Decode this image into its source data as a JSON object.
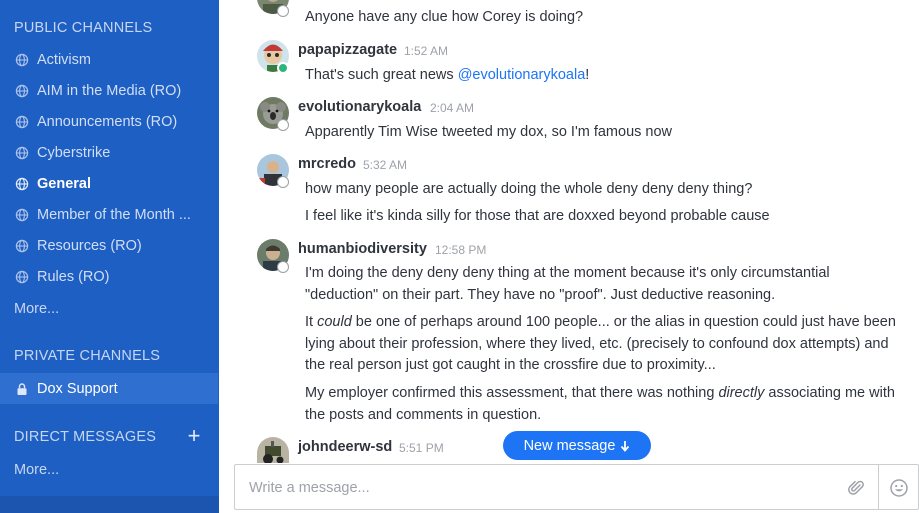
{
  "sidebar": {
    "public_title": "PUBLIC CHANNELS",
    "public_channels": [
      {
        "label": "Activism"
      },
      {
        "label": "AIM in the Media (RO)"
      },
      {
        "label": "Announcements (RO)"
      },
      {
        "label": "Cyberstrike"
      },
      {
        "label": "General"
      },
      {
        "label": "Member of the Month ..."
      },
      {
        "label": "Resources (RO)"
      },
      {
        "label": "Rules (RO)"
      }
    ],
    "public_more": "More...",
    "private_title": "PRIVATE CHANNELS",
    "private_channels": [
      {
        "label": "Dox Support"
      }
    ],
    "direct_title": "DIRECT MESSAGES",
    "direct_add": "+",
    "direct_more": "More...",
    "colors": {
      "background": "#1e5fc4",
      "selected": "#2f6fd0"
    }
  },
  "messages": [
    {
      "lines": [
        "Anyone have any clue how Corey is doing?"
      ]
    },
    {
      "user": "papapizzagate",
      "time": "1:52 AM",
      "status": "online",
      "text_before": "That's such great news ",
      "mention": "@evolutionarykoala",
      "text_after": "!"
    },
    {
      "user": "evolutionarykoala",
      "time": "2:04 AM",
      "status": "offline",
      "lines": [
        "Apparently Tim Wise tweeted my dox, so I'm famous now"
      ]
    },
    {
      "user": "mrcredo",
      "time": "5:32 AM",
      "status": "offline",
      "lines": [
        "how many people are actually doing the whole deny deny deny thing?",
        "I feel like it's kinda silly for those that are doxxed beyond probable cause"
      ]
    },
    {
      "user": "humanbiodiversity",
      "time": "12:58 PM",
      "status": "offline",
      "p1": "I'm doing the deny deny deny thing at the moment because it's only circumstantial \"deduction\" on their part. They have no \"proof\". Just deductive reasoning.",
      "p2_a": "It ",
      "p2_em": "could",
      "p2_b": " be one of perhaps around 100 people... or the alias in question could just have been lying about their profession, where they lived, etc. (precisely to confound dox attempts) and the real person just got caught in the crossfire due to proximity...",
      "p3_a": "My employer confirmed this assessment, that there was nothing ",
      "p3_em": "directly",
      "p3_b": " associating me with the posts and comments in question."
    },
    {
      "user": "johndeerw-sd",
      "time": "5:51 PM",
      "status": "offline"
    }
  ],
  "new_message_label": "New message",
  "composer": {
    "placeholder": "Write a message..."
  },
  "icons": {
    "channel": "globe-icon",
    "private": "lock-icon",
    "attach": "paperclip-icon",
    "emoji": "smiley-icon",
    "arrow": "arrow-down-icon"
  }
}
